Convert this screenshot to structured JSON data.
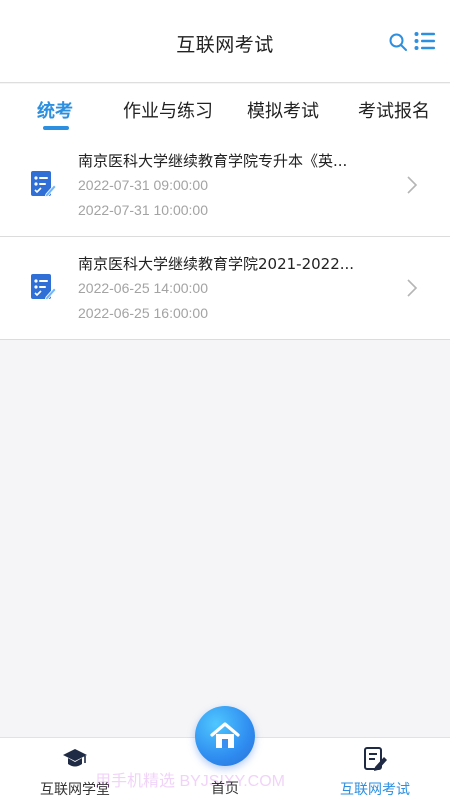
{
  "header": {
    "title": "互联网考试",
    "search_icon": "search-icon",
    "menu_icon": "list-menu-icon"
  },
  "tabs": [
    {
      "label": "统考",
      "active": true
    },
    {
      "label": "作业与练习",
      "active": false
    },
    {
      "label": "模拟考试",
      "active": false
    },
    {
      "label": "考试报名",
      "active": false
    }
  ],
  "exams": [
    {
      "title": "南京医科大学继续教育学院专升本《英...",
      "start": "2022-07-31 09:00:00",
      "end": "2022-07-31 10:00:00",
      "icon": "exam-paper-icon"
    },
    {
      "title": "南京医科大学继续教育学院2021-2022...",
      "start": "2022-06-25 14:00:00",
      "end": "2022-06-25 16:00:00",
      "icon": "exam-paper-icon"
    }
  ],
  "bottom_nav": {
    "left": {
      "label": "互联网学堂",
      "icon": "graduation-cap-icon"
    },
    "center": {
      "label": "首页",
      "icon": "home-icon"
    },
    "right": {
      "label": "互联网考试",
      "icon": "edit-document-icon",
      "active": true
    }
  },
  "watermark": "用手机精选 BYJSIXY.COM",
  "colors": {
    "accent": "#2d8fe0",
    "muted_text": "#a3a3a3",
    "background": "#f5f5f7"
  }
}
